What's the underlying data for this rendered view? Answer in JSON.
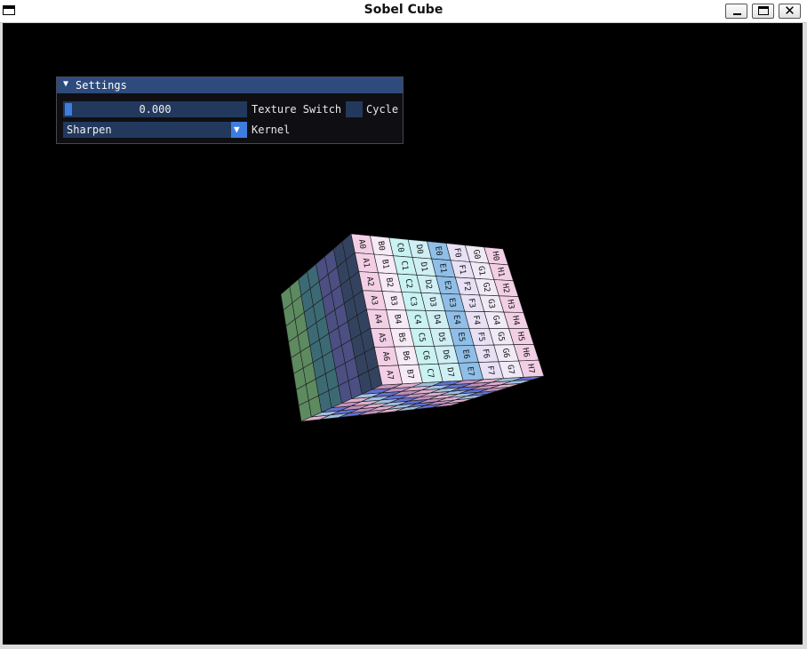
{
  "window": {
    "title": "Sobel Cube",
    "controls": [
      "minimize-icon",
      "maximize-icon",
      "close-icon"
    ],
    "close_glyph": "✕"
  },
  "settings_panel": {
    "title": "Settings",
    "collapse_glyph": "▼",
    "slider": {
      "value": "0.000",
      "label": "Texture Switch"
    },
    "checkbox": {
      "label": "Cycle",
      "checked": false
    },
    "combo": {
      "selected": "Sharpen",
      "label": "Kernel",
      "arrow_glyph": "▼"
    }
  },
  "cube": {
    "front_face_labels": [
      [
        "A0",
        "A1",
        "A2",
        "A3",
        "A4",
        "A5",
        "A6",
        "A7"
      ],
      [
        "B0",
        "B1",
        "B2",
        "B3",
        "B4",
        "B5",
        "B6",
        "B7"
      ],
      [
        "C0",
        "C1",
        "C2",
        "C3",
        "C4",
        "C5",
        "C6",
        "C7"
      ],
      [
        "D0",
        "D1",
        "D2",
        "D3",
        "D4",
        "D5",
        "D6",
        "D7"
      ],
      [
        "E0",
        "E1",
        "E2",
        "E3",
        "E4",
        "E5",
        "E6",
        "E7"
      ],
      [
        "F0",
        "F1",
        "F2",
        "F3",
        "F4",
        "F5",
        "F6",
        "F7"
      ],
      [
        "G0",
        "G1",
        "G2",
        "G3",
        "G4",
        "G5",
        "G6",
        "G7"
      ],
      [
        "H0",
        "H1",
        "H2",
        "H3",
        "H4",
        "H5",
        "H6",
        "H7"
      ]
    ],
    "row_tints": [
      "#f3cfe6",
      "#f6eaf6",
      "#c9f2f2",
      "#cfeff5",
      "#8fbfe8",
      "#e8e0f4",
      "#f0eaf6",
      "#f3cfe6"
    ],
    "left_face_tints": [
      "#5e8a60",
      "#3c6a74",
      "#4b4f82",
      "#33435f"
    ],
    "bottom_face_tints": [
      "#e0b0d0",
      "#a0c0e0",
      "#6070d0",
      "#c090c0"
    ]
  },
  "colors": {
    "viewport_bg": "#000000",
    "panel_header": "#2d4b7c",
    "widget_bg": "#23385d",
    "accent": "#3d7de0"
  }
}
